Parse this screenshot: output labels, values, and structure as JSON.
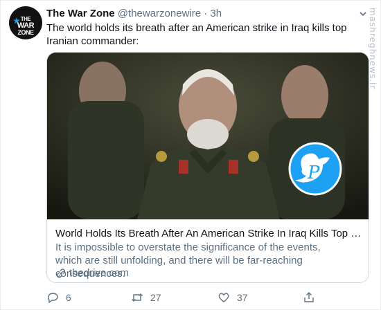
{
  "author": {
    "name": "The War Zone",
    "handle": "@thewarzonewire",
    "separator": "·",
    "time": "3h",
    "avatar_text": [
      "THE",
      "WAR",
      "ZONE"
    ]
  },
  "tweet": {
    "text": "The world holds its breath after an American strike in Iraq kills top Iranian commander:"
  },
  "card": {
    "title": "World Holds Its Breath After An American Strike In Iraq Kills Top Iranian ...",
    "description": "It is impossible to overstate the significance of the events, which are still unfolding, and there will be far-reaching consequences.",
    "domain": "thedrive.com"
  },
  "actions": {
    "reply_count": "6",
    "retweet_count": "27",
    "like_count": "37"
  },
  "watermark": "mashreghnews.ir",
  "colors": {
    "twitter_blue": "#1da1f2",
    "secondary_text": "#5b7083",
    "border": "#cfd9de"
  }
}
